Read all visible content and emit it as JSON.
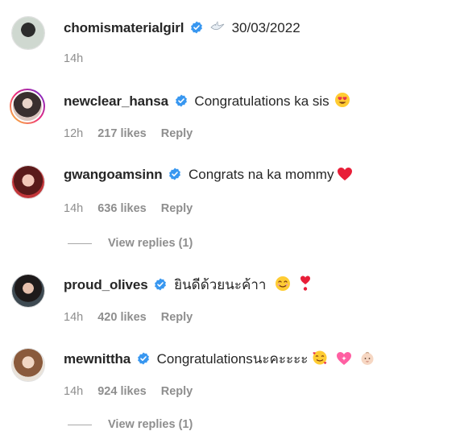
{
  "comments": [
    {
      "username": "chomismaterialgirl",
      "text": "30/03/2022",
      "time": "14h"
    },
    {
      "username": "newclear_hansa",
      "text": "Congratulations ka sis",
      "time": "12h",
      "likes": "217 likes",
      "reply": "Reply"
    },
    {
      "username": "gwangoamsinn",
      "text": "Congrats na ka mommy",
      "time": "14h",
      "likes": "636 likes",
      "reply": "Reply",
      "view_replies": "View replies (1)"
    },
    {
      "username": "proud_olives",
      "text": "ยินดีด้วยนะค้าา",
      "time": "14h",
      "likes": "420 likes",
      "reply": "Reply"
    },
    {
      "username": "mewnittha",
      "text": "Congratulationsนะคะะะะ",
      "time": "14h",
      "likes": "924 likes",
      "reply": "Reply",
      "view_replies": "View replies (1)"
    }
  ],
  "colors": {
    "verified": "#3897f0",
    "meta": "#8e8e8e",
    "text": "#262626"
  }
}
